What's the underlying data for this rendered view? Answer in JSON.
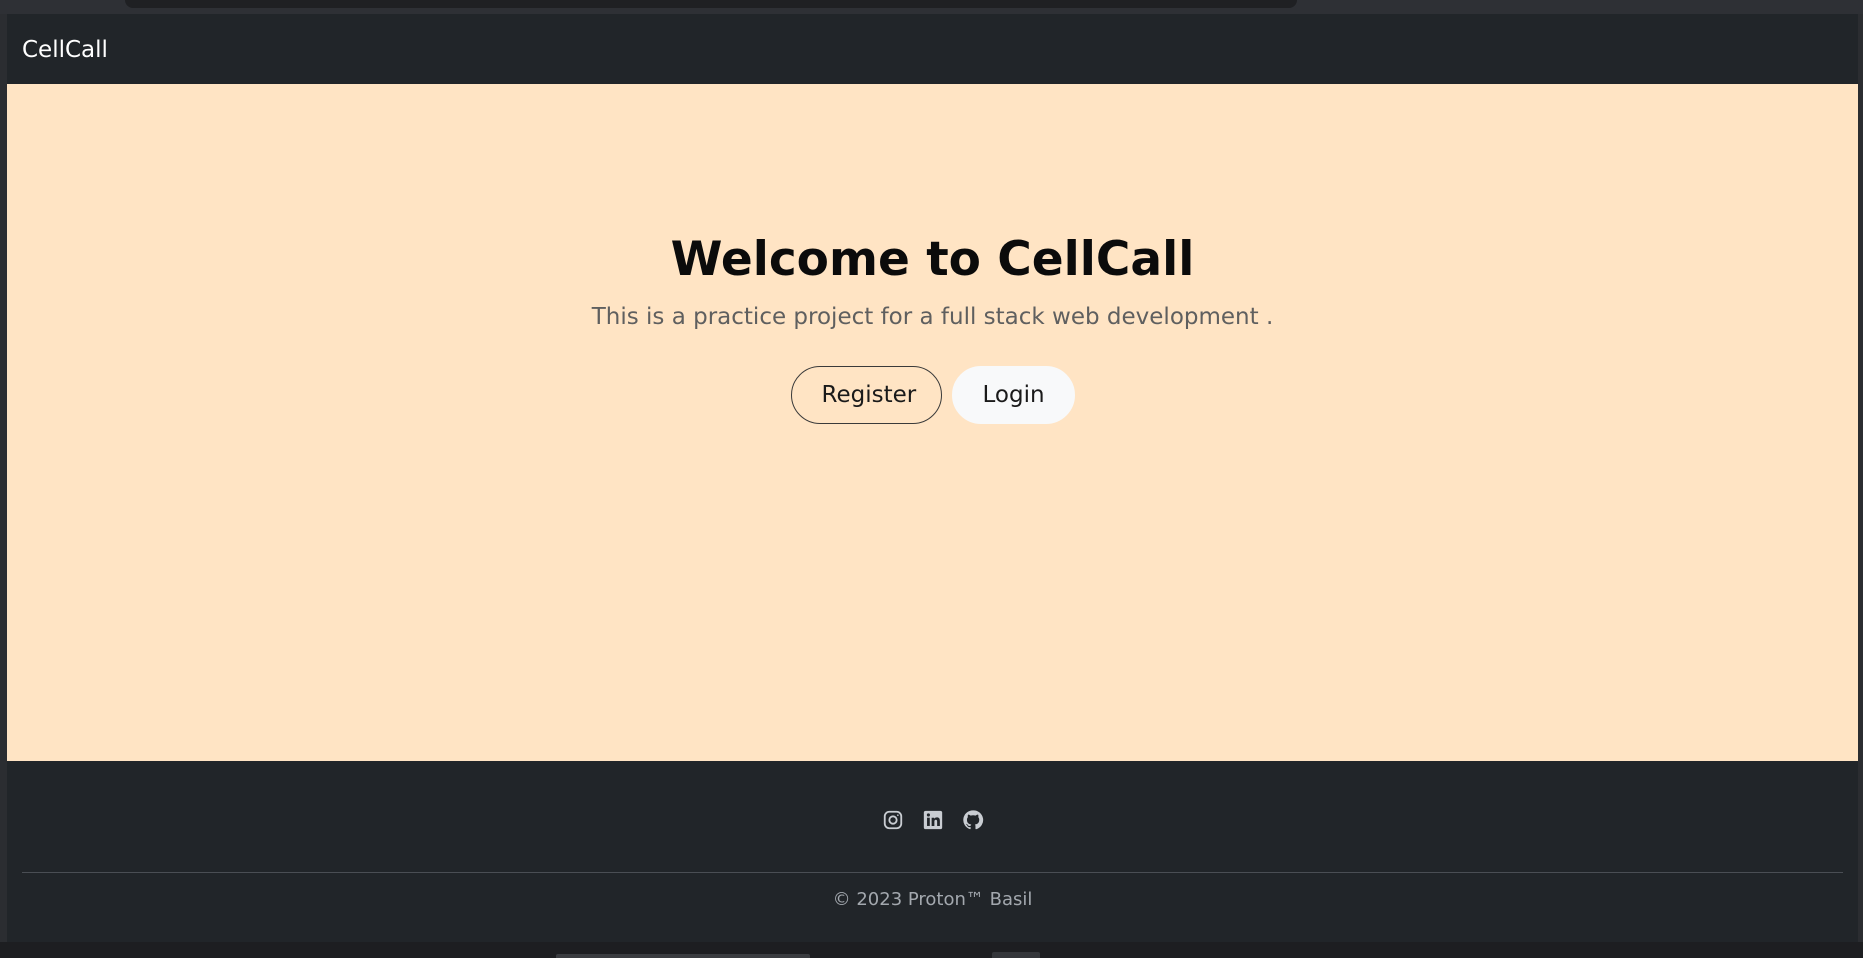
{
  "navbar": {
    "brand": "CellCall"
  },
  "hero": {
    "title": "Welcome to CellCall",
    "subtitle": "This is a practice project for a full stack web development .",
    "register_label": "Register",
    "login_label": "Login"
  },
  "footer": {
    "social_icons": [
      "instagram-icon",
      "linkedin-icon",
      "github-icon"
    ],
    "copyright": "© 2023 Proton™ Basil"
  },
  "colors": {
    "hero_background": "#ffe4c4",
    "navbar_background": "#212529",
    "login_button_background": "#f8f9fa"
  }
}
